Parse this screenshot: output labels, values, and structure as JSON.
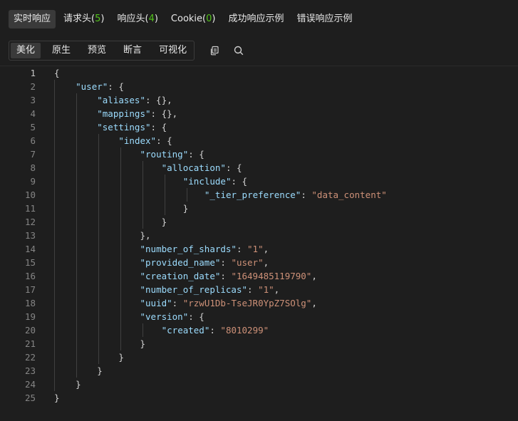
{
  "tabs": [
    {
      "label": "实时响应",
      "count": ""
    },
    {
      "label": "请求头",
      "count": "5"
    },
    {
      "label": "响应头",
      "count": "4"
    },
    {
      "label": "Cookie",
      "count": "0"
    },
    {
      "label": "成功响应示例",
      "count": ""
    },
    {
      "label": "错误响应示例",
      "count": ""
    }
  ],
  "view_modes": [
    "美化",
    "原生",
    "预览",
    "断言",
    "可视化"
  ],
  "icons": {
    "copy": "copy-icon",
    "search": "search-icon"
  },
  "colors": {
    "key": "#9cdcfe",
    "string": "#ce9178",
    "count": "#52c41a"
  },
  "code_lines": [
    {
      "n": "1",
      "text": "{"
    },
    {
      "n": "2",
      "text": "    \"user\": {"
    },
    {
      "n": "3",
      "text": "        \"aliases\": {},"
    },
    {
      "n": "4",
      "text": "        \"mappings\": {},"
    },
    {
      "n": "5",
      "text": "        \"settings\": {"
    },
    {
      "n": "6",
      "text": "            \"index\": {"
    },
    {
      "n": "7",
      "text": "                \"routing\": {"
    },
    {
      "n": "8",
      "text": "                    \"allocation\": {"
    },
    {
      "n": "9",
      "text": "                        \"include\": {"
    },
    {
      "n": "10",
      "text": "                            \"_tier_preference\": \"data_content\""
    },
    {
      "n": "11",
      "text": "                        }"
    },
    {
      "n": "12",
      "text": "                    }"
    },
    {
      "n": "13",
      "text": "                },"
    },
    {
      "n": "14",
      "text": "                \"number_of_shards\": \"1\","
    },
    {
      "n": "15",
      "text": "                \"provided_name\": \"user\","
    },
    {
      "n": "16",
      "text": "                \"creation_date\": \"1649485119790\","
    },
    {
      "n": "17",
      "text": "                \"number_of_replicas\": \"1\","
    },
    {
      "n": "18",
      "text": "                \"uuid\": \"rzwU1Db-TseJR0YpZ7SOlg\","
    },
    {
      "n": "19",
      "text": "                \"version\": {"
    },
    {
      "n": "20",
      "text": "                    \"created\": \"8010299\""
    },
    {
      "n": "21",
      "text": "                }"
    },
    {
      "n": "22",
      "text": "            }"
    },
    {
      "n": "23",
      "text": "        }"
    },
    {
      "n": "24",
      "text": "    }"
    },
    {
      "n": "25",
      "text": "}"
    }
  ]
}
